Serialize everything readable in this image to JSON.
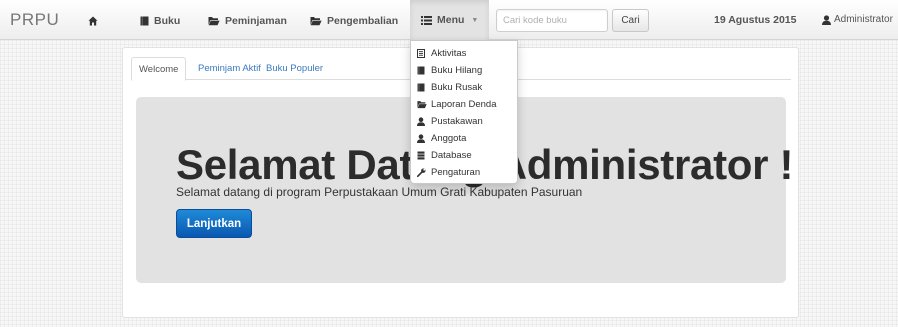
{
  "brand": "PRPU",
  "nav": {
    "home_icon": "home-icon",
    "buku": "Buku",
    "peminjaman": "Peminjaman",
    "pengembalian": "Pengembalian",
    "menu": "Menu",
    "menu_caret": "▼"
  },
  "search": {
    "placeholder": "Cari kode buku",
    "button": "Cari"
  },
  "date": "19 Agustus 2015",
  "user": {
    "name": "Administrator",
    "caret": "▼"
  },
  "tabs": [
    {
      "label": "Welcome",
      "active": true
    },
    {
      "label": "Peminjam Aktif",
      "active": false
    },
    {
      "label": "Buku Populer",
      "active": false
    }
  ],
  "hero": {
    "title": "Selamat Datang Administrator !",
    "subtitle": "Selamat datang di program Perpustakaan Umum Grati Kabupaten Pasuruan",
    "button": "Lanjutkan"
  },
  "menu_items": [
    {
      "label": "Aktivitas",
      "icon": "list-icon"
    },
    {
      "label": "Buku Hilang",
      "icon": "book-icon"
    },
    {
      "label": "Buku Rusak",
      "icon": "book-icon"
    },
    {
      "label": "Laporan Denda",
      "icon": "folder-icon"
    },
    {
      "label": "Pustakawan",
      "icon": "user-icon"
    },
    {
      "label": "Anggota",
      "icon": "user-icon"
    },
    {
      "label": "Database",
      "icon": "database-icon"
    },
    {
      "label": "Pengaturan",
      "icon": "wrench-icon"
    }
  ],
  "colors": {
    "accent": "#0b62c1",
    "link": "#3b7bbf",
    "jumbotron": "#e2e2e2",
    "navbar": "#f4f4f4"
  }
}
